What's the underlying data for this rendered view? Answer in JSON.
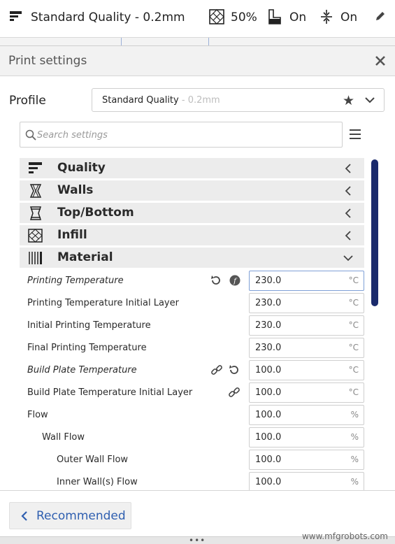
{
  "topbar": {
    "profile_label": "Standard Quality - 0.2mm",
    "infill_value": "50%",
    "support_value": "On",
    "adhesion_value": "On"
  },
  "panel": {
    "title": "Print settings",
    "profile_label": "Profile",
    "profile_name": "Standard Quality",
    "profile_suffix": " - 0.2mm",
    "search_placeholder": "Search settings"
  },
  "categories": [
    {
      "label": "Quality",
      "icon": "quality-icon",
      "expanded": false
    },
    {
      "label": "Walls",
      "icon": "walls-icon",
      "expanded": false
    },
    {
      "label": "Top/Bottom",
      "icon": "top-bottom-icon",
      "expanded": false
    },
    {
      "label": "Infill",
      "icon": "infill-icon",
      "expanded": false
    },
    {
      "label": "Material",
      "icon": "material-icon",
      "expanded": true
    }
  ],
  "settings": [
    {
      "label": "Printing Temperature",
      "value": "230.0",
      "unit": "°C",
      "italic": true,
      "indent": 0,
      "icons": [
        "reset-icon",
        "function-icon"
      ]
    },
    {
      "label": "Printing Temperature Initial Layer",
      "value": "230.0",
      "unit": "°C",
      "italic": false,
      "indent": 0,
      "icons": []
    },
    {
      "label": "Initial Printing Temperature",
      "value": "230.0",
      "unit": "°C",
      "italic": false,
      "indent": 0,
      "icons": []
    },
    {
      "label": "Final Printing Temperature",
      "value": "230.0",
      "unit": "°C",
      "italic": false,
      "indent": 0,
      "icons": []
    },
    {
      "label": "Build Plate Temperature",
      "value": "100.0",
      "unit": "°C",
      "italic": true,
      "indent": 0,
      "icons": [
        "link-icon",
        "reset-icon"
      ]
    },
    {
      "label": "Build Plate Temperature Initial Layer",
      "value": "100.0",
      "unit": "°C",
      "italic": false,
      "indent": 0,
      "icons": [
        "link-icon"
      ]
    },
    {
      "label": "Flow",
      "value": "100.0",
      "unit": "%",
      "italic": false,
      "indent": 0,
      "icons": []
    },
    {
      "label": "Wall Flow",
      "value": "100.0",
      "unit": "%",
      "italic": false,
      "indent": 1,
      "icons": []
    },
    {
      "label": "Outer Wall Flow",
      "value": "100.0",
      "unit": "%",
      "italic": false,
      "indent": 2,
      "icons": []
    },
    {
      "label": "Inner Wall(s) Flow",
      "value": "100.0",
      "unit": "%",
      "italic": false,
      "indent": 2,
      "icons": []
    }
  ],
  "bottom": {
    "recommended_label": "Recommended",
    "handle_dots": "•••"
  },
  "watermark": "www.mfgrobots.com"
}
